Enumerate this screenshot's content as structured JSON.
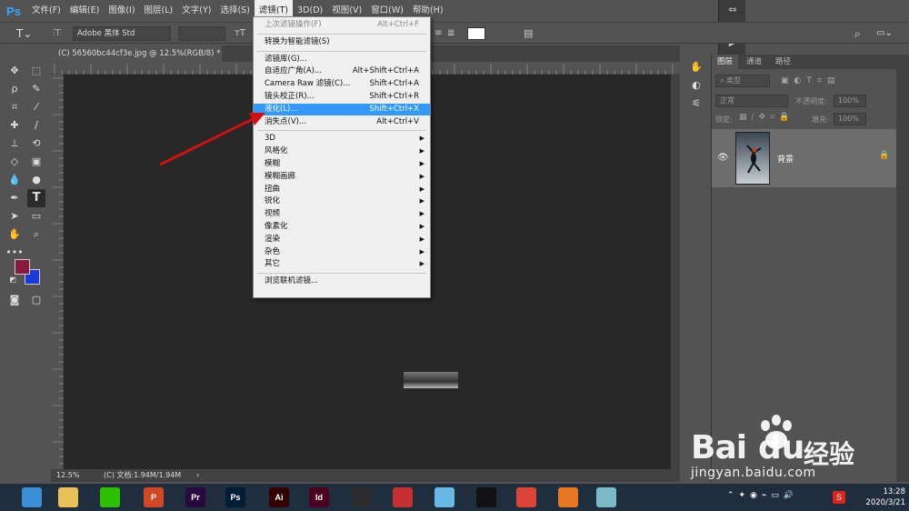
{
  "app": {
    "logo": "Ps",
    "menus": [
      "文件(F)",
      "编辑(E)",
      "图像(I)",
      "图层(L)",
      "文字(Y)",
      "选择(S)",
      "滤镜(T)",
      "3D(D)",
      "视图(V)",
      "窗口(W)",
      "帮助(H)"
    ],
    "active_menu_index": 6
  },
  "options": {
    "font_family": "Adobe 黑体 Std"
  },
  "document": {
    "tab_title": "(C) 56560bc44cf3e.jpg @ 12.5%(RGB/8) *",
    "close": "×",
    "zoom": "12.5%",
    "doc_info": "(C) 文档:1.94M/1.94M",
    "status_arrow": "›"
  },
  "filter_menu": [
    {
      "label": "上次滤镜操作(F)",
      "shortcut": "Alt+Ctrl+F",
      "disabled": true
    },
    {
      "sep": true
    },
    {
      "label": "转换为智能滤镜(S)",
      "shortcut": ""
    },
    {
      "sep": true
    },
    {
      "label": "滤镜库(G)...",
      "shortcut": ""
    },
    {
      "label": "自适应广角(A)...",
      "shortcut": "Alt+Shift+Ctrl+A"
    },
    {
      "label": "Camera Raw 滤镜(C)...",
      "shortcut": "Shift+Ctrl+A"
    },
    {
      "label": "镜头校正(R)...",
      "shortcut": "Shift+Ctrl+R"
    },
    {
      "label": "液化(L)...",
      "shortcut": "Shift+Ctrl+X",
      "hover": true
    },
    {
      "label": "消失点(V)...",
      "shortcut": "Alt+Ctrl+V"
    },
    {
      "sep": true
    },
    {
      "label": "3D",
      "submenu": true
    },
    {
      "label": "风格化",
      "submenu": true
    },
    {
      "label": "模糊",
      "submenu": true
    },
    {
      "label": "模糊画廊",
      "submenu": true
    },
    {
      "label": "扭曲",
      "submenu": true
    },
    {
      "label": "锐化",
      "submenu": true
    },
    {
      "label": "视频",
      "submenu": true
    },
    {
      "label": "像素化",
      "submenu": true
    },
    {
      "label": "渲染",
      "submenu": true
    },
    {
      "label": "杂色",
      "submenu": true
    },
    {
      "label": "其它",
      "submenu": true
    },
    {
      "sep": true
    },
    {
      "label": "浏览联机滤镜...",
      "shortcut": ""
    }
  ],
  "layers_panel": {
    "tabs": [
      "图层",
      "通道",
      "路径"
    ],
    "kind_placeholder": "类型",
    "blend_mode": "正常",
    "opacity_label": "不透明度:",
    "opacity_value": "100%",
    "lock_label": "锁定:",
    "fill_label": "填充:",
    "fill_value": "100%",
    "layer_name": "背景"
  },
  "taskbar": {
    "apps": [
      {
        "name": "browser",
        "text": "",
        "color": "#3b8fd6"
      },
      {
        "name": "explorer",
        "text": "",
        "color": "#e8c15a"
      },
      {
        "name": "wechat",
        "text": "",
        "color": "#2dc100"
      },
      {
        "name": "powerpoint",
        "text": "P",
        "color": "#d24726"
      },
      {
        "name": "premiere",
        "text": "Pr",
        "color": "#2a0a3e"
      },
      {
        "name": "photoshop",
        "text": "Ps",
        "color": "#001e36"
      },
      {
        "name": "illustrator",
        "text": "Ai",
        "color": "#330000"
      },
      {
        "name": "indesign",
        "text": "Id",
        "color": "#49021f"
      },
      {
        "name": "video",
        "text": "",
        "color": "#2c2c2c"
      },
      {
        "name": "app-red",
        "text": "",
        "color": "#c73030"
      },
      {
        "name": "app-blue",
        "text": "",
        "color": "#6ab8e6"
      },
      {
        "name": "qq",
        "text": "",
        "color": "#111111"
      },
      {
        "name": "chrome",
        "text": "",
        "color": "#db4437"
      },
      {
        "name": "app-orange",
        "text": "",
        "color": "#e87722"
      },
      {
        "name": "app-cyan",
        "text": "",
        "color": "#7bb8c8"
      }
    ],
    "time": "13:28",
    "date": "2020/3/21"
  },
  "watermark": {
    "brand": "Bai",
    "brand_suffix": "经验",
    "domain": "jingyan.baidu.com"
  },
  "colors": {
    "foreground": "#8a1a3d",
    "background": "#1a3bd9",
    "menu_highlight": "#3399ff",
    "annotation_arrow": "#d11111"
  }
}
